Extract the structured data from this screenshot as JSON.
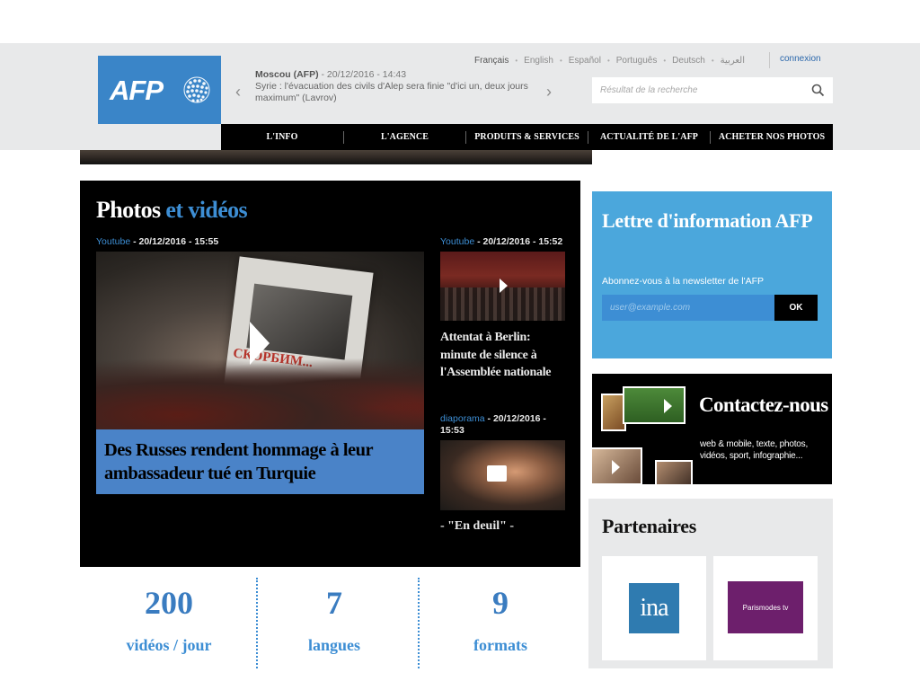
{
  "header": {
    "languages": [
      "Français",
      "English",
      "Español",
      "Português",
      "Deutsch",
      "العربية"
    ],
    "active_language": "Français",
    "login_label": "connexion",
    "search": {
      "placeholder": "Résultat de la recherche"
    },
    "ticker": {
      "meta": "Moscou (AFP)",
      "time": " - 20/12/2016 - 14:43",
      "text": "Syrie : l'évacuation des civils d'Alep sera finie \"d'ici un, deux jours maximum\" (Lavrov)"
    },
    "logo_text": "AFP",
    "nav": [
      "L'INFO",
      "L'AGENCE",
      "PRODUITS & SERVICES",
      "ACTUALITÉ DE L'AFP",
      "ACHETER NOS PHOTOS"
    ]
  },
  "videos": {
    "title_part1": "Photos",
    "title_part2": " et vidéos",
    "main": {
      "source": "Youtube",
      "date": " - 20/12/2016 - 15:55",
      "sign_text": "СКОРБИМ...",
      "caption": "Des Russes rendent hommage à leur ambassadeur tué en Turquie"
    },
    "side1": {
      "source": "Youtube",
      "date": " - 20/12/2016 - 15:52",
      "title": "Attentat à Berlin: minute de silence à l'Assemblée nationale"
    },
    "side2": {
      "source": "diaporama",
      "date": " - 20/12/2016 - 15:53",
      "title": "- \"En deuil\" -"
    }
  },
  "stats": [
    {
      "value": "200",
      "label": "vidéos / jour"
    },
    {
      "value": "7",
      "label": "langues"
    },
    {
      "value": "9",
      "label": "formats"
    }
  ],
  "newsletter": {
    "title": "Lettre d'information AFP",
    "subtitle": "Abonnez-vous à la newsletter de l'AFP",
    "placeholder": "user@example.com",
    "button": "OK"
  },
  "contact": {
    "title": "Contactez-nous",
    "text": "web & mobile, texte, photos, vidéos, sport, infographie..."
  },
  "partners": {
    "title": "Partenaires",
    "items": [
      "ina",
      "Parismodes tv"
    ]
  },
  "colors": {
    "accent_blue": "#3a85c8",
    "newsletter_blue": "#4ba7dc",
    "caption_blue": "#4a83c8"
  }
}
